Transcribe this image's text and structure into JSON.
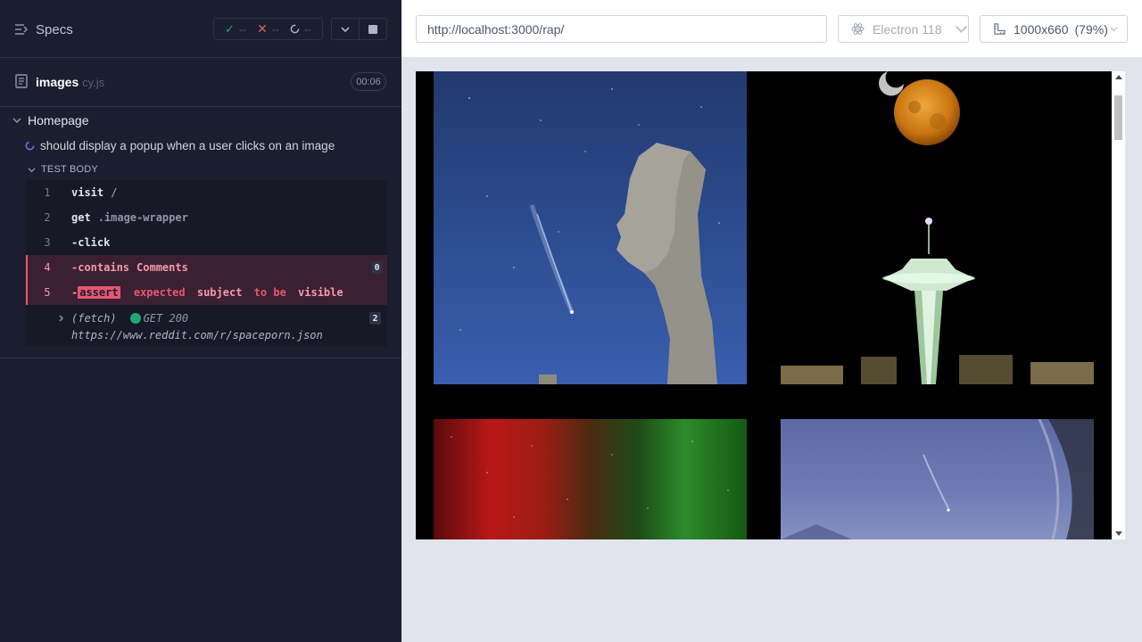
{
  "specs_bar": {
    "label": "Specs"
  },
  "stats": {
    "passed": "--",
    "failed": "--",
    "pending": "--"
  },
  "spec_file": {
    "name": "images",
    "ext": "cy.js",
    "duration": "00:06"
  },
  "suite": {
    "title": "Homepage"
  },
  "test": {
    "title": "should display a popup when a user clicks on an image",
    "section_label": "TEST BODY"
  },
  "commands": [
    {
      "num": "1",
      "name": "visit",
      "message": "/"
    },
    {
      "num": "2",
      "name": "get",
      "message": ".image-wrapper"
    },
    {
      "num": "3",
      "name": "-click",
      "message": ""
    },
    {
      "num": "4",
      "name": "-contains",
      "message": "Comments",
      "badge": "0"
    },
    {
      "num": "5",
      "name": "-",
      "tag": "assert",
      "parts": [
        "expected",
        "subject",
        "to be",
        "visible"
      ]
    }
  ],
  "fetch": {
    "label": "(fetch)",
    "status": "GET 200",
    "url": "https://www.reddit.com/r/spaceporn.json",
    "badge": "2"
  },
  "browser": {
    "url": "http://localhost:3000/rap/",
    "name": "Electron 118",
    "viewport": "1000x660",
    "scale": "(79%)"
  },
  "colors": {
    "panel_bg": "#1b1e2e",
    "fail": "#e45770",
    "pass": "#1fa971",
    "app_bg": "#e1e3ed"
  }
}
